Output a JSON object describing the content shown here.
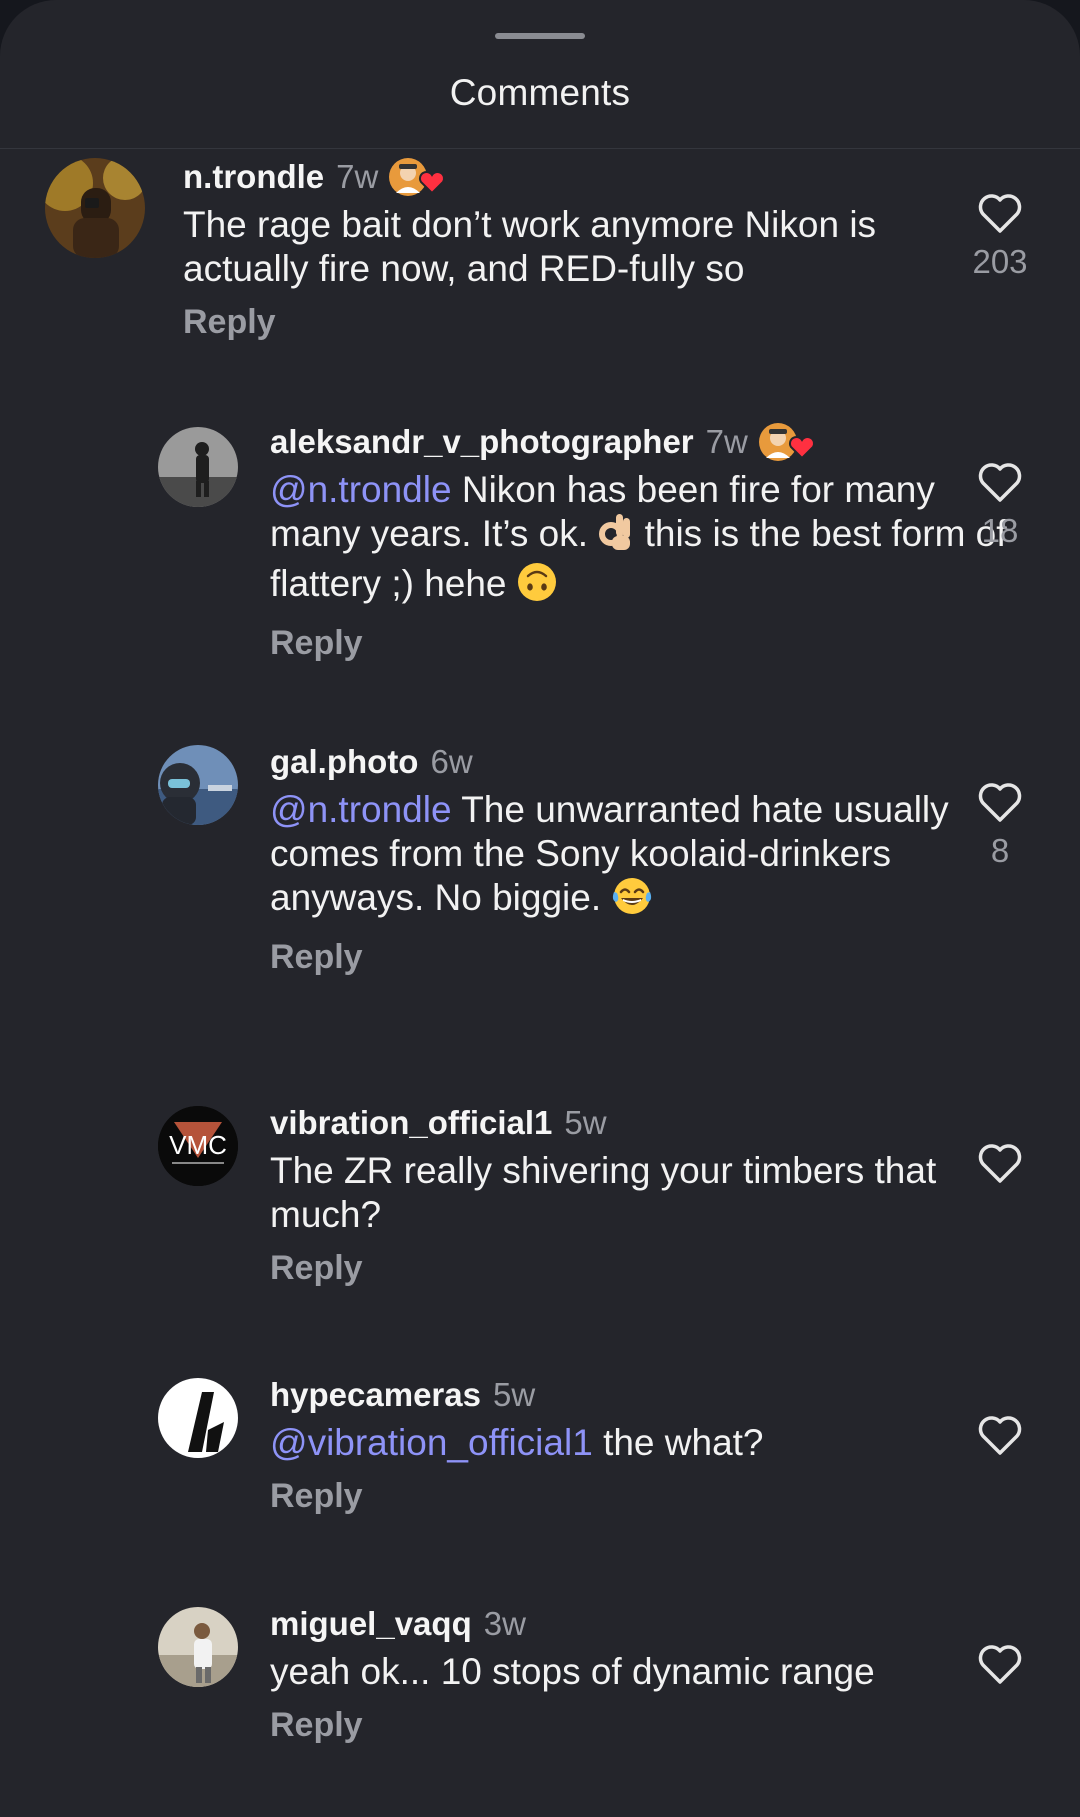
{
  "sheet": {
    "title": "Comments"
  },
  "comments": [
    {
      "username": "n.trondle",
      "time": "7w",
      "mention": "",
      "text": "The rage bait don’t work anymore Nikon is actually fire now, and RED-fully so",
      "reply_label": "Reply",
      "likes": "203",
      "creator_liked": true,
      "avatar": "person-autumn-avatar"
    },
    {
      "username": "aleksandr_v_photographer",
      "time": "7w",
      "mention": "n.trondle",
      "text": "Nikon has been fire for many many years. It’s ok.",
      "text_after_ok": "this is the best form of flattery ;) hehe",
      "reply_label": "Reply",
      "likes": "18",
      "creator_liked": true,
      "avatar": "person-bw-avatar"
    },
    {
      "username": "gal.photo",
      "time": "6w",
      "mention": "n.trondle",
      "text": "The unwarranted hate usually comes from the Sony koolaid-drinkers anyways. No biggie.",
      "reply_label": "Reply",
      "likes": "8",
      "creator_liked": false,
      "avatar": "person-pilot-avatar"
    },
    {
      "username": "vibration_official1",
      "time": "5w",
      "mention": "",
      "text": "The ZR really shivering your timbers that much?",
      "reply_label": "Reply",
      "likes": "",
      "creator_liked": false,
      "avatar": "vmc-logo-avatar",
      "avatar_text": "VMC"
    },
    {
      "username": "hypecameras",
      "time": "5w",
      "mention": "vibration_official1",
      "text": "the what?",
      "reply_label": "Reply",
      "likes": "",
      "creator_liked": false,
      "avatar": "hypecameras-logo-avatar"
    },
    {
      "username": "miguel_vaqq",
      "time": "3w",
      "mention": "",
      "text": "yeah ok... 10 stops of dynamic range",
      "reply_label": "Reply",
      "likes": "",
      "creator_liked": false,
      "avatar": "person-standing-avatar"
    }
  ],
  "colors": {
    "background": "#24252b",
    "mention": "#8e93f7",
    "muted": "#9a9ca3",
    "text": "#f2f2f2",
    "heart_badge": "#ff3040"
  },
  "icons": [
    "heart-outline-icon",
    "threads-at-icon",
    "creator-heart-badge-icon"
  ]
}
